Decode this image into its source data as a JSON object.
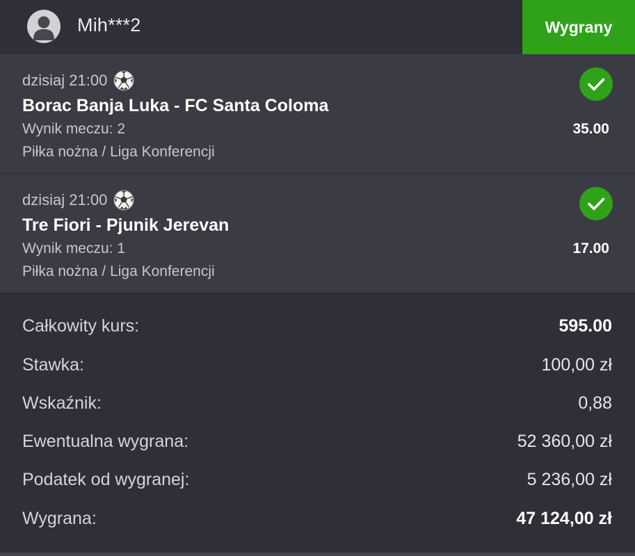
{
  "header": {
    "username": "Mih***2",
    "status": "Wygrany",
    "status_color": "#2fa21a"
  },
  "bets": [
    {
      "time": "dzisiaj 21:00",
      "sport_icon": "soccer-ball-icon",
      "match": "Borac Banja Luka - FC Santa Coloma",
      "pick": "Wynik meczu: 2",
      "league": "Piłka nożna / Liga Konferencji",
      "odds": "35.00",
      "result_icon": "check-icon"
    },
    {
      "time": "dzisiaj 21:00",
      "sport_icon": "soccer-ball-icon",
      "match": "Tre Fiori - Pjunik Jerevan",
      "pick": "Wynik meczu: 1",
      "league": "Piłka nożna / Liga Konferencji",
      "odds": "17.00",
      "result_icon": "check-icon"
    }
  ],
  "summary": {
    "total_odds_label": "Całkowity kurs:",
    "total_odds_value": "595.00",
    "stake_label": "Stawka:",
    "stake_value": "100,00 zł",
    "factor_label": "Wskaźnik:",
    "factor_value": "0,88",
    "potential_win_label": "Ewentualna wygrana:",
    "potential_win_value": "52 360,00 zł",
    "tax_label": "Podatek od wygranej:",
    "tax_value": "5 236,00 zł",
    "win_label": "Wygrana:",
    "win_value": "47 124,00 zł"
  }
}
